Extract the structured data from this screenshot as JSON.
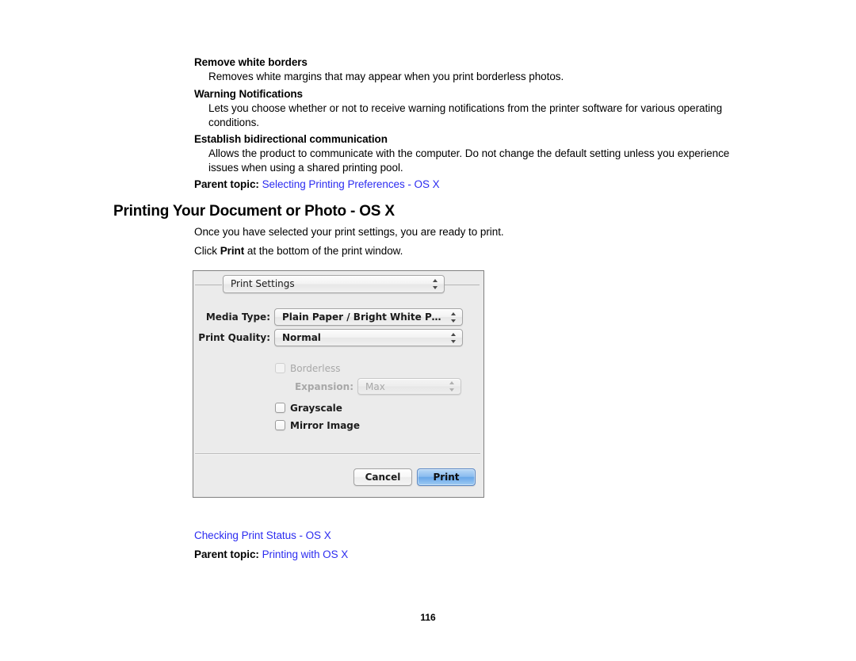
{
  "document": {
    "page_number": "116",
    "glossary": [
      {
        "term": "Remove white borders",
        "definition": "Removes white margins that may appear when you print borderless photos."
      },
      {
        "term": "Warning Notifications",
        "definition": "Lets you choose whether or not to receive warning notifications from the printer software for various operating conditions."
      },
      {
        "term": "Establish bidirectional communication",
        "definition": "Allows the product to communicate with the computer. Do not change the default setting unless you experience issues when using a shared printing pool."
      }
    ],
    "parent_topic_top": {
      "label": "Parent topic:",
      "link": "Selecting Printing Preferences - OS X"
    },
    "section_heading": "Printing Your Document or Photo - OS X",
    "intro_line": "Once you have selected your print settings, you are ready to print.",
    "instruction_line": {
      "before": "Click ",
      "bold": "Print",
      "after": " at the bottom of the print window."
    },
    "related_link": "Checking Print Status - OS X",
    "parent_topic_bottom": {
      "label": "Parent topic:",
      "link": "Printing with OS X"
    },
    "link_color": "#2c2cf0"
  },
  "print_dialog": {
    "pane_popup": {
      "value": "Print Settings",
      "options": [
        "Print Settings"
      ]
    },
    "fields": [
      {
        "label": "Media Type:",
        "value": "Plain Paper / Bright White Paper",
        "options": [
          "Plain Paper / Bright White Paper"
        ]
      },
      {
        "label": "Print Quality:",
        "value": "Normal",
        "options": [
          "Normal"
        ]
      }
    ],
    "borderless": {
      "label": "Borderless",
      "checked": false,
      "enabled": false
    },
    "expansion": {
      "label": "Expansion:",
      "value": "Max",
      "enabled": false,
      "options": [
        "Max"
      ]
    },
    "grayscale": {
      "label": "Grayscale",
      "checked": false
    },
    "mirror_image": {
      "label": "Mirror Image",
      "checked": false
    },
    "buttons": {
      "cancel": "Cancel",
      "print": "Print"
    },
    "default_button_color": "#8cbdef"
  }
}
